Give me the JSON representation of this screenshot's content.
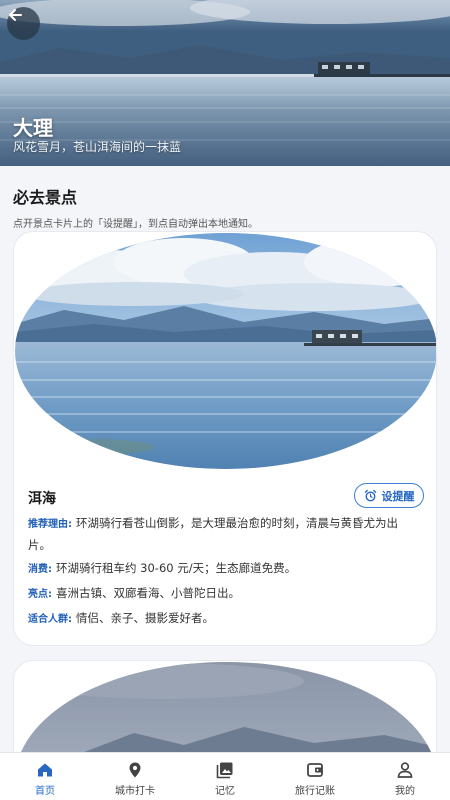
{
  "header": {
    "title": "大理",
    "subtitle": "风花雪月，苍山洱海间的一抹蓝"
  },
  "section": {
    "title": "必去景点",
    "hint": "点开景点卡片上的「设提醒」，到点自动弹出本地通知。"
  },
  "spots": [
    {
      "name": "洱海",
      "remind_label": "设提醒",
      "reason_key": "推荐理由:",
      "reason": "环湖骑行看苍山倒影，是大理最治愈的时刻，清晨与黄昏尤为出片。",
      "cost_key": "消费:",
      "cost": "环湖骑行租车约 30-60 元/天；生态廊道免费。",
      "highlight_key": "亮点:",
      "highlight": "喜洲古镇、双廊看海、小普陀日出。",
      "audience_key": "适合人群:",
      "audience": "情侣、亲子、摄影爱好者。"
    }
  ],
  "nav": {
    "items": [
      {
        "label": "首页",
        "icon": "home-icon",
        "active": true
      },
      {
        "label": "城市打卡",
        "icon": "location-pin-icon",
        "active": false
      },
      {
        "label": "记忆",
        "icon": "photo-album-icon",
        "active": false
      },
      {
        "label": "旅行记账",
        "icon": "wallet-icon",
        "active": false
      },
      {
        "label": "我的",
        "icon": "user-icon",
        "active": false
      }
    ]
  },
  "colors": {
    "accent": "#2868c3",
    "background": "#f3f5f9"
  }
}
